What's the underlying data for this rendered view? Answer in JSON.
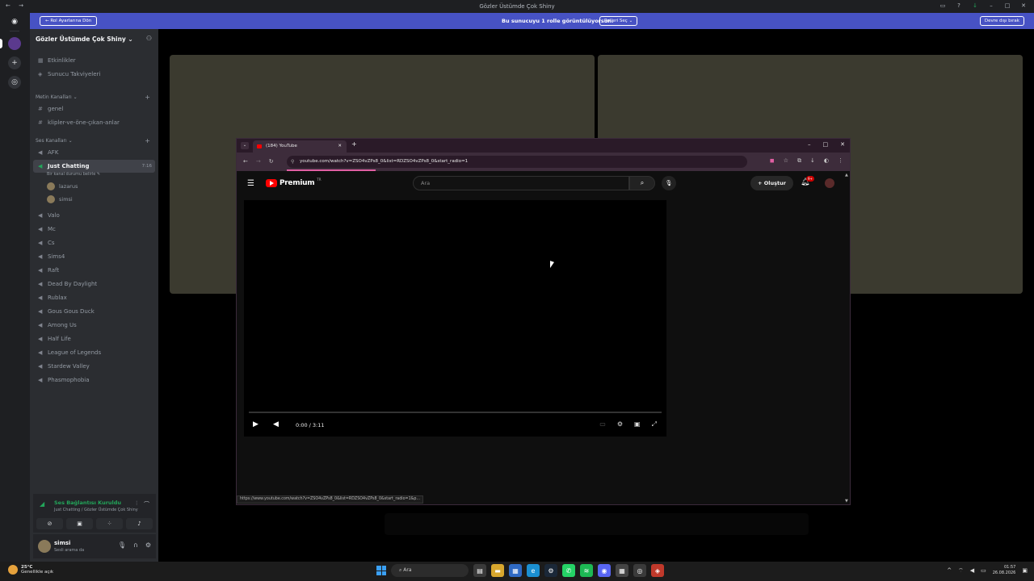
{
  "titlebar": {
    "title": "Gözler Üstümde Çok Shiny",
    "nav": "← →"
  },
  "notice": {
    "back_label": "← Rol Ayarlarına Dön",
    "message": "Bu sunucuyu 1 rolle görüntülüyorsun.",
    "roles_label": "Rolleri Seç ⌄",
    "leave_label": "Devre dışı bırak"
  },
  "server": {
    "name": "Gözler Üstümde Çok Shiny ⌄"
  },
  "sidebar": {
    "events": "Etkinlikler",
    "boosts": "Sunucu Takviyeleri",
    "text_category": "Metin Kanalları ⌄",
    "text_channels": [
      "genel",
      "klipler-ve-öne-çıkan-anlar"
    ],
    "voice_category": "Ses Kanalları ⌄",
    "afk": "AFK",
    "active_channel": "Just Chatting",
    "active_timer": "7:16",
    "active_status": "Bir kanal durumu belirle ✎",
    "voice_users": [
      "lazarus",
      "simsi"
    ],
    "voice_channels": [
      "Valo",
      "Mc",
      "Cs",
      "Sims4",
      "Raft",
      "Dead By Daylight",
      "Rublax",
      "Gous Gous Duck",
      "Among Us",
      "Half Life",
      "League of Legends",
      "Stardew Valley",
      "Phasmophobia"
    ]
  },
  "voice": {
    "status": "Ses Bağlantısı Kuruldu",
    "sub": "Just Chatting / Gözler Üstümde Çok Shiny"
  },
  "user": {
    "name": "simsi",
    "status": "Sesli arama da"
  },
  "browser": {
    "tab_title": "(184) YouTube",
    "url": "youtube.com/watch?v=ZSO4vZPs8_0&list=RDZSO4vZPs8_0&start_radio=1",
    "status_url": "https://www.youtube.com/watch?v=ZSO4vZPs8_0&list=RDZSO4vZPs8_0&start_radio=1&p..."
  },
  "youtube": {
    "logo": "Premium",
    "tm": "TR",
    "search_placeholder": "Ara",
    "create_label": "+ Oluştur",
    "notif_badge": "9+",
    "time": "0:00 / 3:11"
  },
  "taskbar": {
    "temp": "25°C",
    "weather": "Genellikle açık",
    "search": "Ara",
    "time": "01:57",
    "date": "26.08.2026"
  }
}
